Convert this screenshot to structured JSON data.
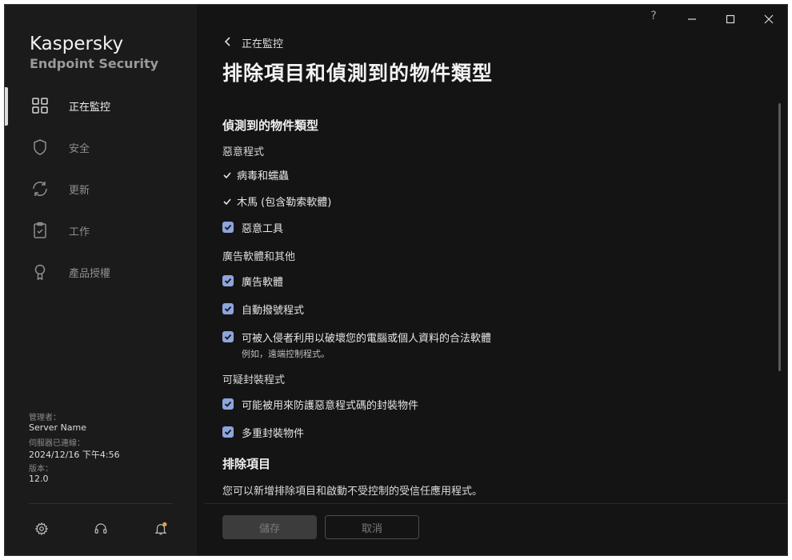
{
  "app": {
    "brand_line1": "Kaspersky",
    "brand_line2": "Endpoint Security"
  },
  "titlebar": {
    "help": "?"
  },
  "sidebar": {
    "items": [
      {
        "label": "正在監控",
        "icon": "grid-icon",
        "active": true
      },
      {
        "label": "安全",
        "icon": "shield-icon"
      },
      {
        "label": "更新",
        "icon": "refresh-icon"
      },
      {
        "label": "工作",
        "icon": "clipboard-icon"
      },
      {
        "label": "產品授權",
        "icon": "award-icon"
      }
    ],
    "info": {
      "admin_label": "管理者：",
      "admin_value": "Server Name",
      "server_label": "伺服器已連線：",
      "server_value": "2024/12/16 下午4:56",
      "version_label": "版本：",
      "version_value": "12.0"
    }
  },
  "header": {
    "breadcrumb": "正在監控",
    "title": "排除項目和偵測到的物件類型"
  },
  "main": {
    "detected_title": "偵測到的物件類型",
    "malware_group": "惡意程式",
    "fixed_items": [
      "病毒和蠕蟲",
      "木馬 (包含勒索軟體)"
    ],
    "malicious_tools": "惡意工具",
    "adware_group": "廣告軟體和其他",
    "adware": "廣告軟體",
    "autodialers": "自動撥號程式",
    "legit_software": "可被入侵者利用以破壞您的電腦或個人資料的合法軟體",
    "legit_example": "例如，遠端控制程式。",
    "packers_group": "可疑封裝程式",
    "packed_objects": "可能被用來防護惡意程式碼的封裝物件",
    "multipacked": "多重封裝物件",
    "exclusions_title": "排除項目",
    "exclusions_desc": "您可以新增排除項目和啟動不受控制的受信任應用程式。"
  },
  "footer": {
    "save": "儲存",
    "cancel": "取消"
  },
  "colors": {
    "checkbox": "#8ea4dc",
    "notification_dot": "#e0a63a"
  }
}
